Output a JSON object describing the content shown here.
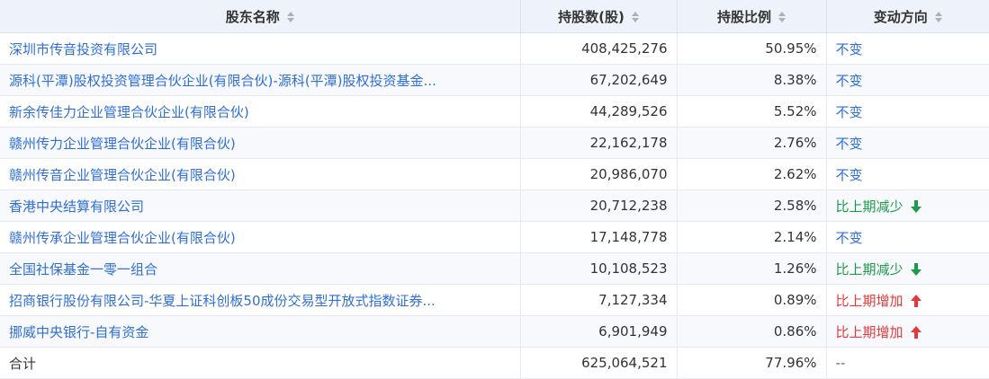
{
  "header": {
    "name": "股东名称",
    "shares": "持股数(股)",
    "ratio": "持股比例",
    "change": "变动方向"
  },
  "rows": [
    {
      "name": "深圳市传音投资有限公司",
      "shares": "408,425,276",
      "ratio": "50.95%",
      "change": "不变",
      "dir": "same"
    },
    {
      "name": "源科(平潭)股权投资管理合伙企业(有限合伙)-源科(平潭)股权投资基金...",
      "shares": "67,202,649",
      "ratio": "8.38%",
      "change": "不变",
      "dir": "same"
    },
    {
      "name": "新余传佳力企业管理合伙企业(有限合伙)",
      "shares": "44,289,526",
      "ratio": "5.52%",
      "change": "不变",
      "dir": "same"
    },
    {
      "name": "赣州传力企业管理合伙企业(有限合伙)",
      "shares": "22,162,178",
      "ratio": "2.76%",
      "change": "不变",
      "dir": "same"
    },
    {
      "name": "赣州传音企业管理合伙企业(有限合伙)",
      "shares": "20,986,070",
      "ratio": "2.62%",
      "change": "不变",
      "dir": "same"
    },
    {
      "name": "香港中央结算有限公司",
      "shares": "20,712,238",
      "ratio": "2.58%",
      "change": "比上期减少",
      "dir": "down"
    },
    {
      "name": "赣州传承企业管理合伙企业(有限合伙)",
      "shares": "17,148,778",
      "ratio": "2.14%",
      "change": "不变",
      "dir": "same"
    },
    {
      "name": "全国社保基金一零一组合",
      "shares": "10,108,523",
      "ratio": "1.26%",
      "change": "比上期减少",
      "dir": "down"
    },
    {
      "name": "招商银行股份有限公司-华夏上证科创板50成份交易型开放式指数证券...",
      "shares": "7,127,334",
      "ratio": "0.89%",
      "change": "比上期增加",
      "dir": "up"
    },
    {
      "name": "挪威中央银行-自有资金",
      "shares": "6,901,949",
      "ratio": "0.86%",
      "change": "比上期增加",
      "dir": "up"
    }
  ],
  "total": {
    "name": "合计",
    "shares": "625,064,521",
    "ratio": "77.96%",
    "change": "--"
  },
  "colors": {
    "link": "#2f6fd6",
    "down": "#1e9a4a",
    "up": "#e4393c",
    "header_bg": "#eef2fb"
  }
}
